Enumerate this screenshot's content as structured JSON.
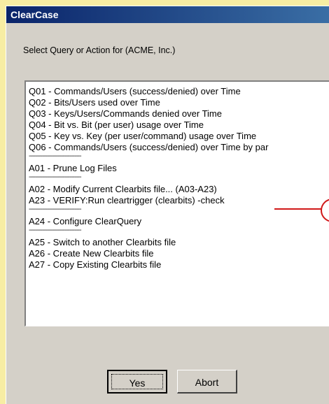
{
  "window": {
    "title": "ClearCase"
  },
  "prompt": "Select Query or Action for (ACME, Inc.)",
  "list": {
    "items": [
      "Q01 - Commands/Users (success/denied) over Time",
      "Q02 - Bits/Users used over Time",
      "Q03 - Keys/Users/Commands denied over Time",
      "Q04 - Bit vs. Bit (per user) usage over Time",
      "Q05 - Key vs. Key (per user/command) usage over Time",
      "Q06 - Commands/Users (success/denied) over Time by par",
      "--------------------------------",
      "A01 - Prune Log Files",
      "--------------------------------",
      "A02 - Modify Current Clearbits file... (A03-A23)",
      "A23 - VERIFY:Run cleartrigger (clearbits) -check",
      "--------------------------------",
      "A24 - Configure ClearQuery",
      "--------------------------------",
      "A25 - Switch to another Clearbits file",
      "A26 - Create New Clearbits file",
      "A27 - Copy Existing Clearbits file"
    ]
  },
  "buttons": {
    "yes": "Yes",
    "abort": "Abort"
  },
  "colors": {
    "annotation": "#d01818",
    "background": "#f7eda3",
    "dialog": "#d4d0c8",
    "titlebar": "#0a246a"
  }
}
